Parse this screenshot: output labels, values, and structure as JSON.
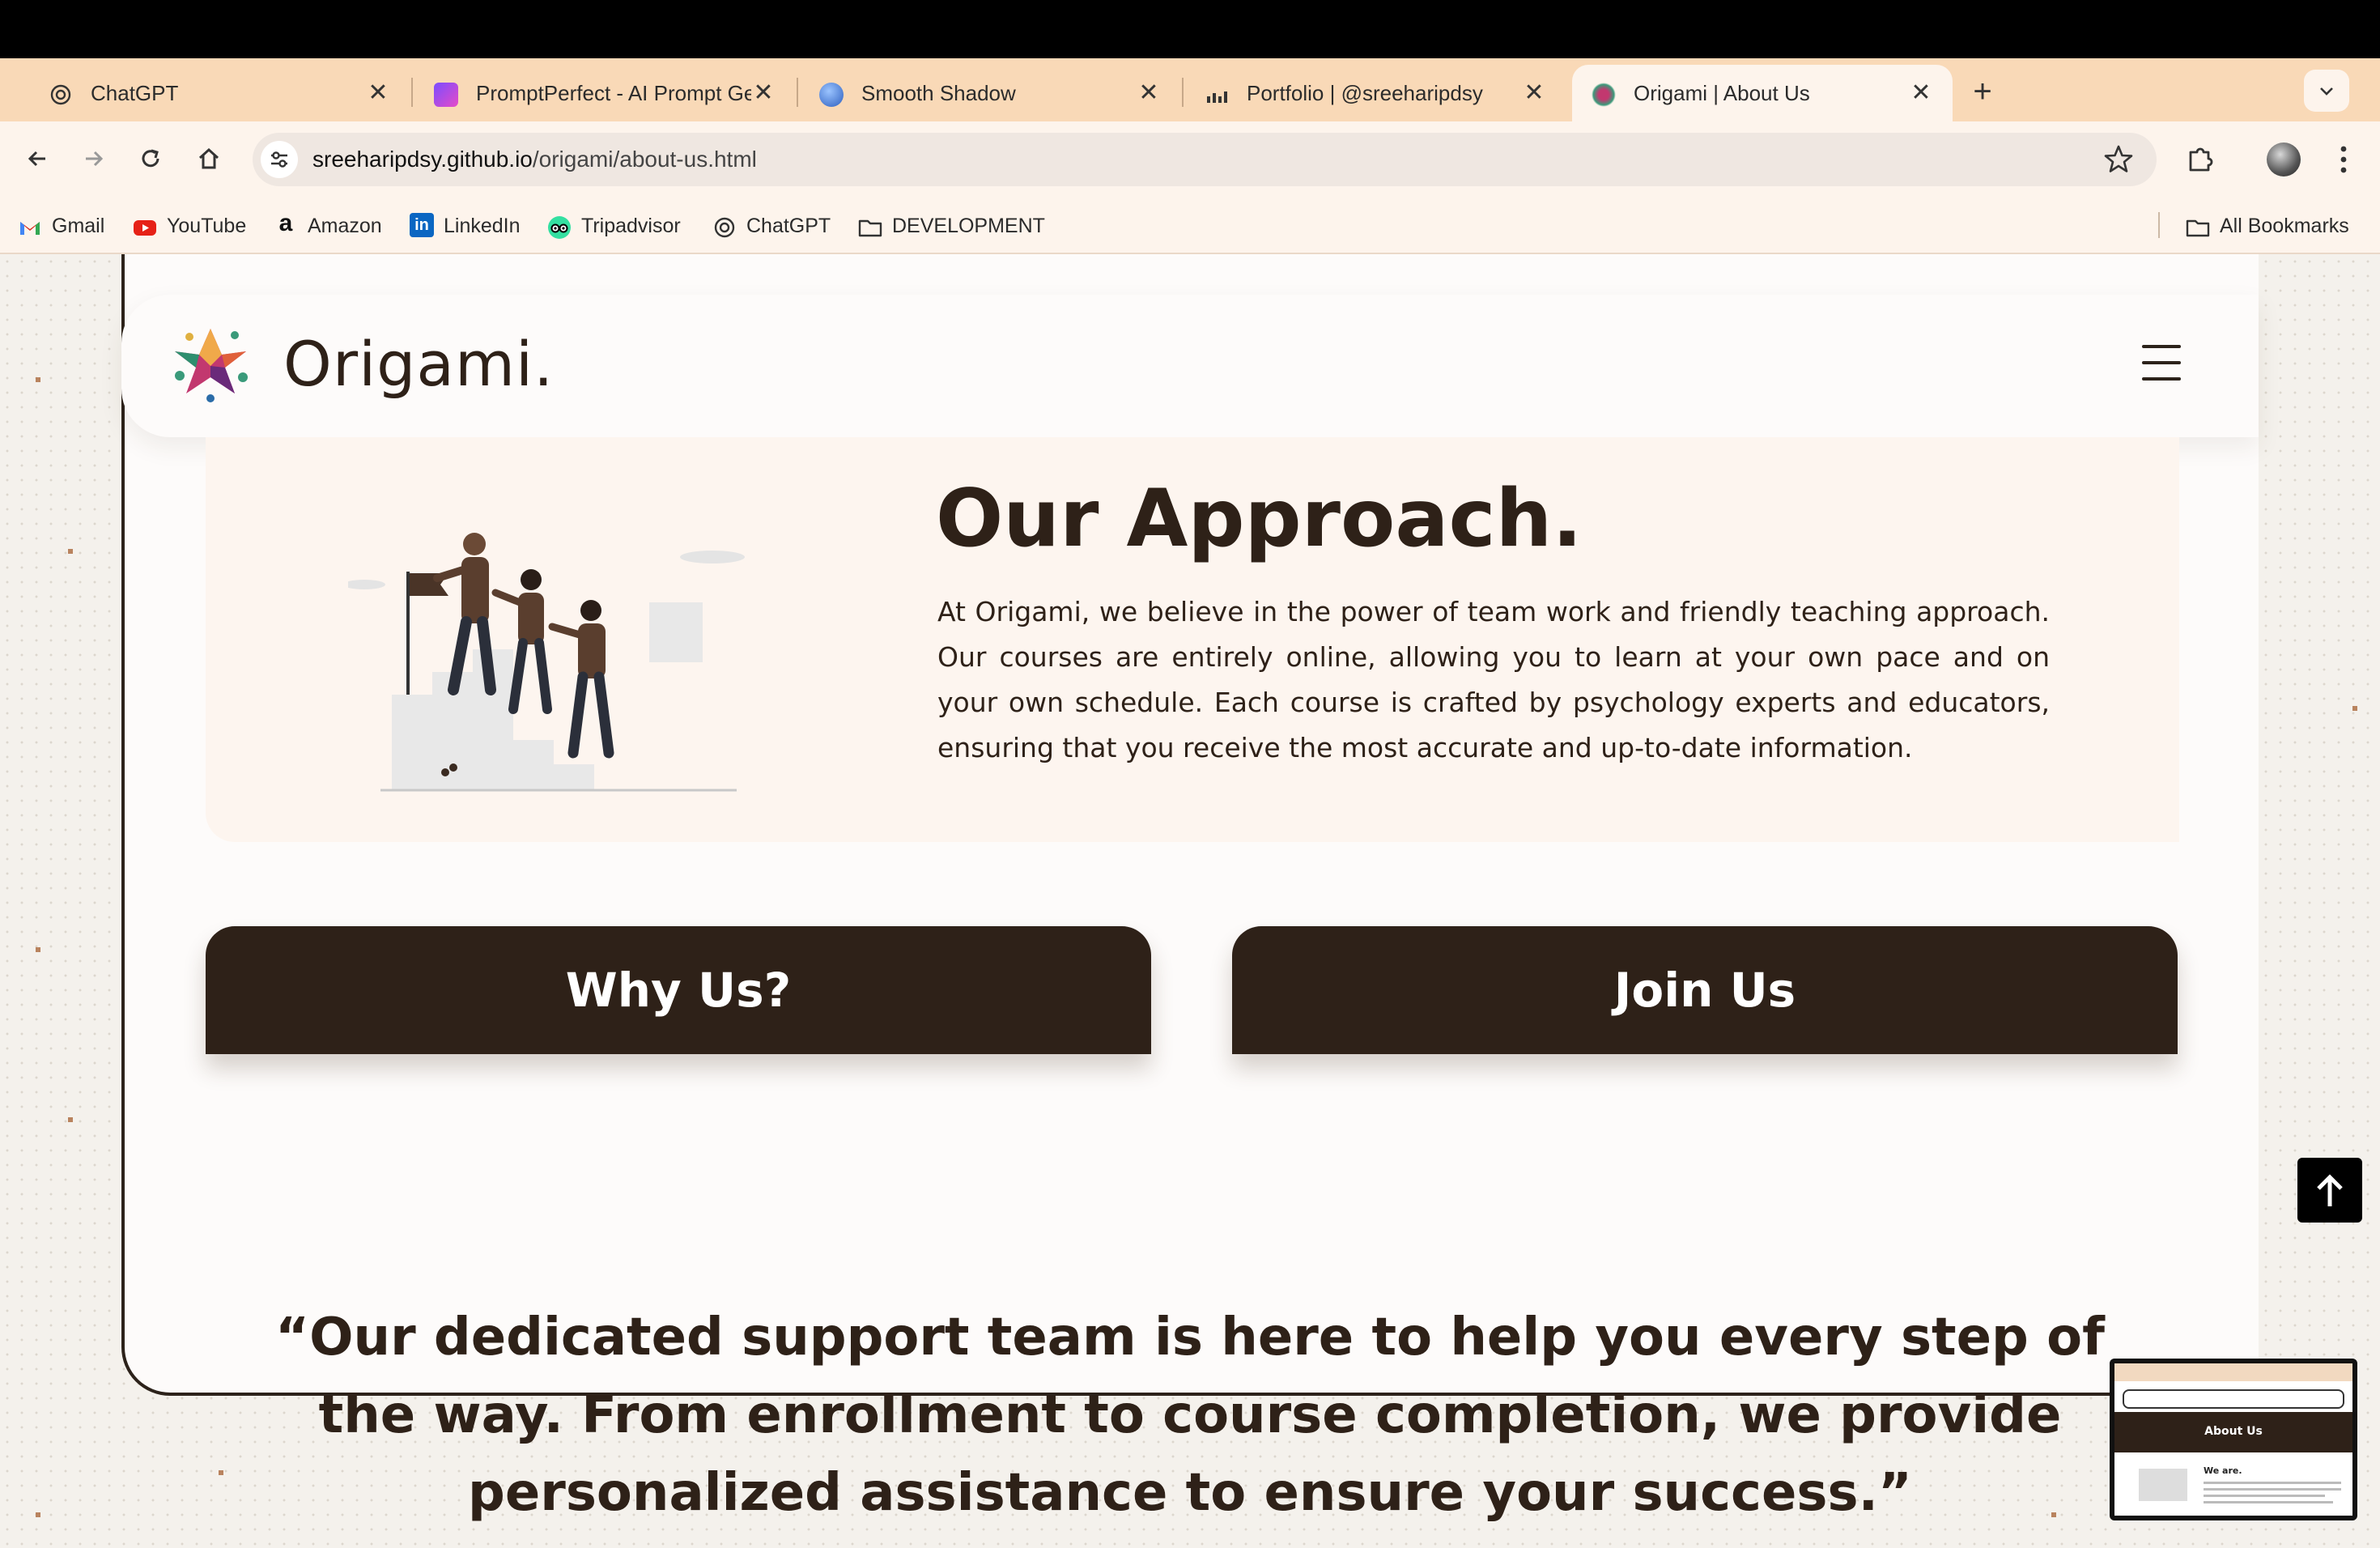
{
  "browser": {
    "tabs": [
      {
        "title": "ChatGPT",
        "icon": "chatgpt-icon",
        "active": false
      },
      {
        "title": "PromptPerfect - AI Prompt Generator",
        "icon": "promptperfect-icon",
        "active": false
      },
      {
        "title": "Smooth Shadow",
        "icon": "smooth-shadow-icon",
        "active": false
      },
      {
        "title": "Portfolio | @sreeharipdsy",
        "icon": "portfolio-icon",
        "active": false
      },
      {
        "title": "Origami | About Us",
        "icon": "origami-icon",
        "active": true
      }
    ],
    "new_tab_label": "+",
    "close_glyph": "✕",
    "url_host": "sreeharipdsy.github.io",
    "url_path": "/origami/about-us.html",
    "bookmarks": [
      {
        "label": "Gmail",
        "icon": "gmail-icon"
      },
      {
        "label": "YouTube",
        "icon": "youtube-icon"
      },
      {
        "label": "Amazon",
        "icon": "amazon-icon"
      },
      {
        "label": "LinkedIn",
        "icon": "linkedin-icon"
      },
      {
        "label": "Tripadvisor",
        "icon": "tripadvisor-icon"
      },
      {
        "label": "ChatGPT",
        "icon": "chatgpt-icon"
      },
      {
        "label": "DEVELOPMENT",
        "icon": "folder-icon"
      }
    ],
    "all_bookmarks_label": "All Bookmarks",
    "colors": {
      "tabstrip": "#f9d9b7",
      "toolbar": "#fdf4ec",
      "omnibox": "#efe7e1"
    }
  },
  "page": {
    "brand": "Origami.",
    "approach": {
      "title": "Our Approach.",
      "body": "At Origami, we believe in the power of team work and friendly teaching approach. Our courses are entirely online, allowing you to learn at your own pace and on your own schedule. Each course is crafted by psychology experts and educators, ensuring that you receive the most accurate and up-to-date information."
    },
    "buttons": {
      "why": "Why Us?",
      "join": "Join Us"
    },
    "quote": "“Our dedicated support team is here to help you every step of the way. From enrollment to course completion, we provide personalized assistance to ensure your success.”",
    "colors": {
      "primary": "#2e2118",
      "card": "#fdfbfa",
      "approach_bg": "#fdf5ef",
      "accent_dot": "#b9835e"
    }
  },
  "pip_preview": {
    "banner_title": "About Us",
    "heading": "We are."
  }
}
